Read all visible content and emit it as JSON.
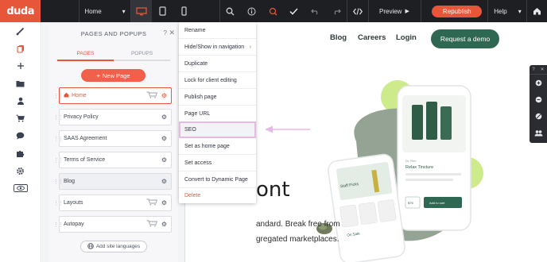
{
  "topbar": {
    "logo": "duda",
    "page_select": "Home",
    "preview_label": "Preview",
    "republish_label": "Republish",
    "help_label": "Help"
  },
  "panel": {
    "title": "PAGES AND POPUPS",
    "help": "?",
    "tabs": [
      "PAGES",
      "POPUPS"
    ],
    "new_page_label": "New Page",
    "pages": [
      {
        "label": "Home",
        "icons": [
          "home-icon",
          "cart-icon",
          "gear-icon"
        ]
      },
      {
        "label": "Privacy Policy",
        "icons": [
          "gear-icon"
        ]
      },
      {
        "label": "SAAS Agreement",
        "icons": [
          "gear-icon"
        ]
      },
      {
        "label": "Terms of Service",
        "icons": [
          "gear-icon"
        ]
      },
      {
        "label": "Blog",
        "icons": [
          "gear-icon"
        ]
      },
      {
        "label": "Layouts",
        "icons": [
          "cart-icon",
          "gear-icon"
        ]
      },
      {
        "label": "Autopay",
        "icons": [
          "cart-icon",
          "gear-icon"
        ]
      }
    ],
    "add_languages_label": "Add site languages"
  },
  "context_menu": {
    "items": [
      "Rename",
      "Hide/Show in navigation",
      "Duplicate",
      "Lock for client editing",
      "Publish page",
      "Page URL",
      "SEO",
      "Set as home page",
      "Set access",
      "Convert to Dynamic Page",
      "Delete"
    ],
    "highlighted": "SEO"
  },
  "site": {
    "nav": [
      "Blog",
      "Careers",
      "Login"
    ],
    "cta": "Request a demo",
    "hero_word": "ont",
    "hero_line1": "andard. Break free from",
    "hero_line2": "gregated marketplaces.",
    "phone_texts": {
      "staff_picks": "Staff Picks",
      "relax": "Relax Tincture",
      "on_sale": "On Sale",
      "add_to_cart": "Add to cart",
      "price": "$76"
    }
  },
  "colors": {
    "brand": "#e8563a",
    "topbar": "#1e1f23",
    "cta": "#2f6852",
    "highlight_border": "#e7b9e5",
    "decor_green": "#cdeb8b"
  }
}
